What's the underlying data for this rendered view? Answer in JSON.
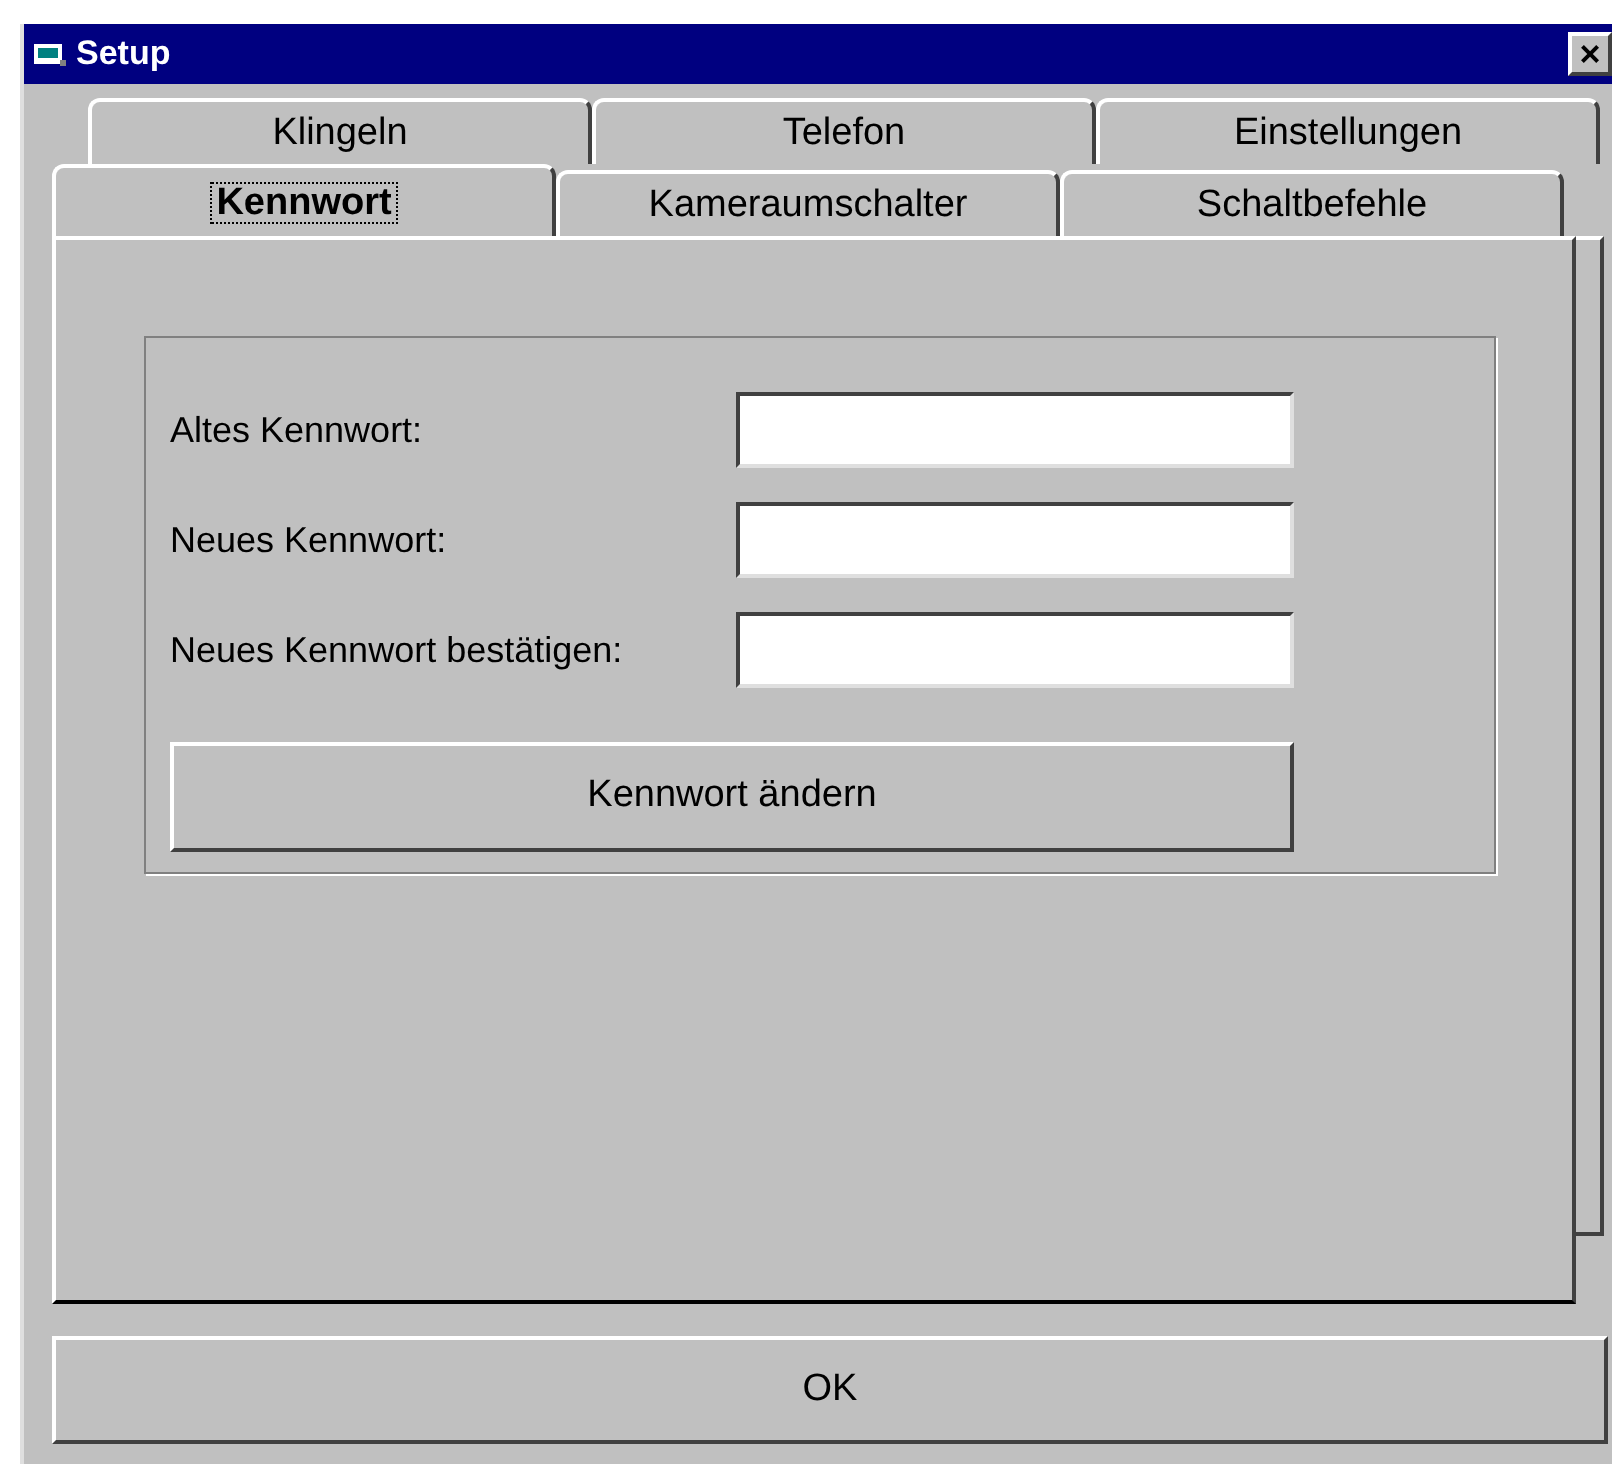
{
  "window": {
    "title": "Setup",
    "close": "×"
  },
  "tab_rows": [
    [
      {
        "label": "Klingeln",
        "selected": false
      },
      {
        "label": "Telefon",
        "selected": false
      },
      {
        "label": "Einstellungen",
        "selected": false
      }
    ],
    [
      {
        "label": "Kennwort",
        "selected": true
      },
      {
        "label": "Kameraumschalter",
        "selected": false
      },
      {
        "label": "Schaltbefehle",
        "selected": false
      }
    ]
  ],
  "fields": [
    {
      "label": "Altes Kennwort:"
    },
    {
      "label": "Neues Kennwort:"
    },
    {
      "label": "Neues Kennwort bestätigen:"
    }
  ],
  "change_button": "Kennwort ändern",
  "ok_button": "OK"
}
